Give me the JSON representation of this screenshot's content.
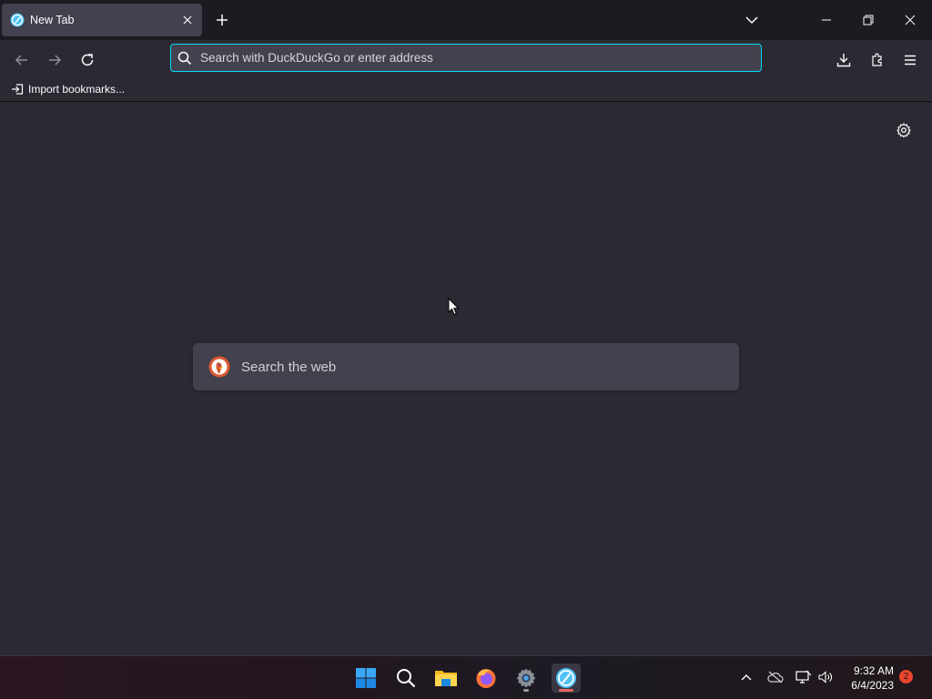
{
  "browser": {
    "tab": {
      "title": "New Tab",
      "favicon": "browser-logo-icon",
      "close_icon": "close-icon"
    },
    "new_tab_icon": "plus-icon",
    "tab_list_icon": "chevron-down-icon",
    "window_controls": [
      "minimize-icon",
      "restore-icon",
      "close-icon"
    ]
  },
  "navbar": {
    "back_icon": "back-arrow-icon",
    "forward_icon": "forward-arrow-icon",
    "reload_icon": "reload-icon",
    "url_placeholder": "Search with DuckDuckGo or enter address",
    "url_value": "",
    "right_icons": [
      "download-icon",
      "extensions-icon",
      "menu-icon"
    ]
  },
  "bookmarks": {
    "import_label": "Import bookmarks..."
  },
  "newtab": {
    "settings_icon": "gear-icon",
    "search_placeholder": "Search the web",
    "search_engine_icon": "duckduckgo-icon"
  },
  "taskbar": {
    "apps": [
      "windows-start-icon",
      "search-icon",
      "file-explorer-icon",
      "firefox-icon",
      "settings-icon",
      "browser-icon"
    ],
    "tray_icons": [
      "chevron-up-icon",
      "cloud-off-icon",
      "network-icon",
      "volume-icon"
    ],
    "time": "9:32 AM",
    "date": "6/4/2023",
    "notification_count": "2"
  },
  "colors": {
    "accent": "#00ddff",
    "bg": "#2b2a33",
    "toolbar": "#1c1b22",
    "field": "#42414d"
  }
}
